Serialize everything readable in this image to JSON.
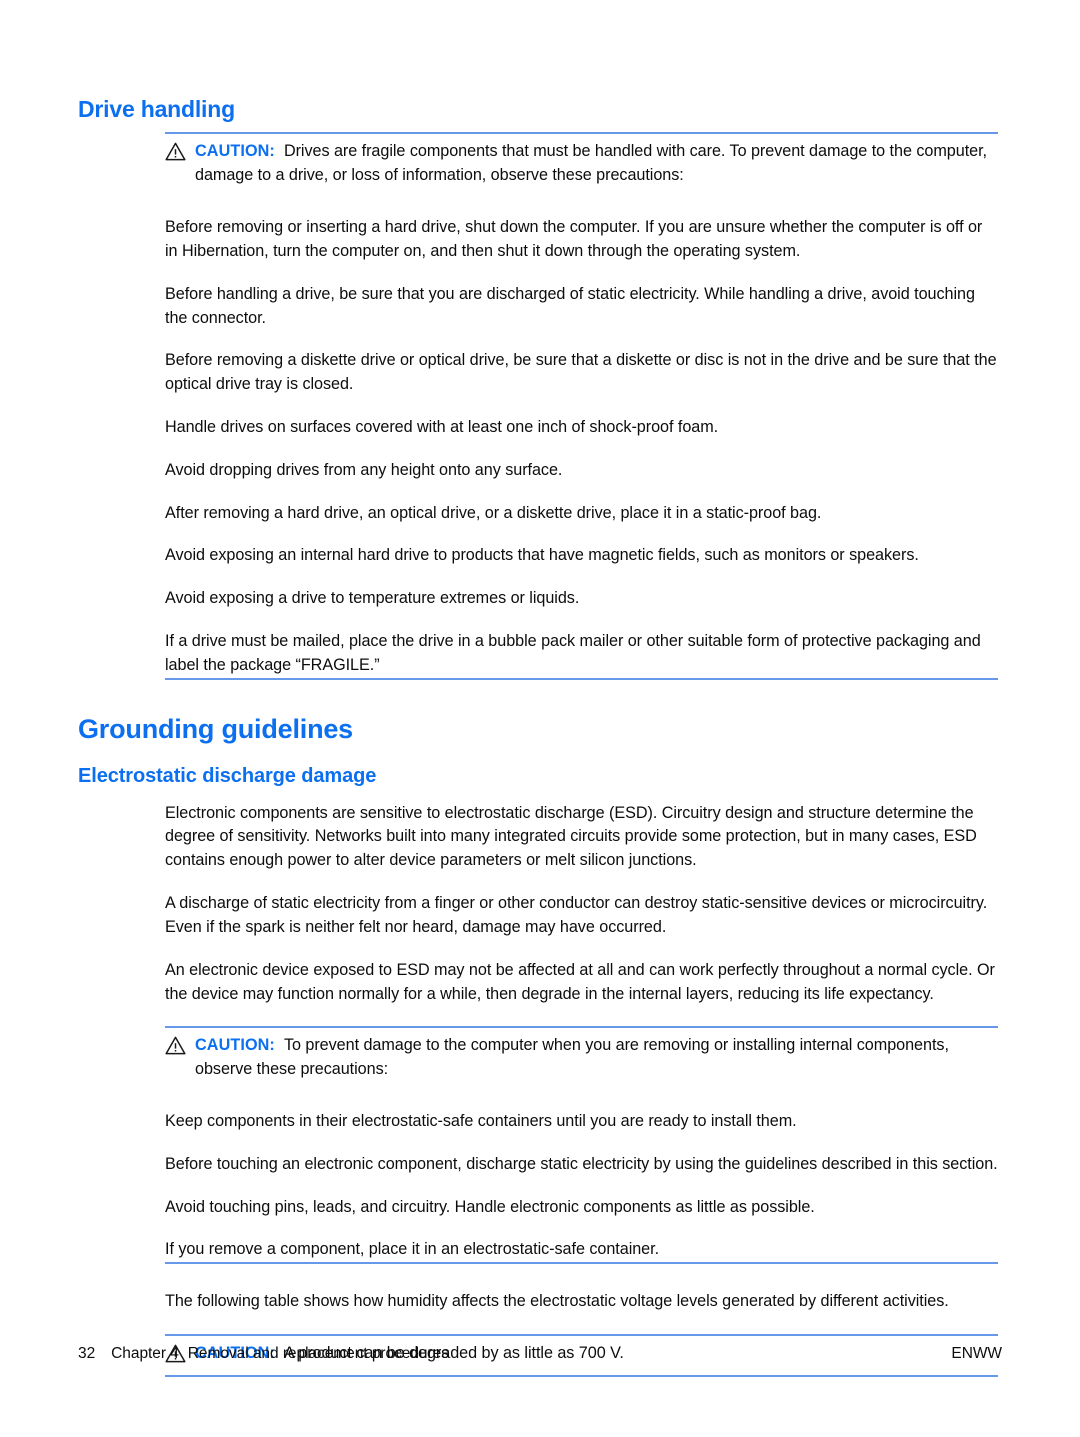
{
  "document": {
    "sections": [
      {
        "heading": "Drive handling",
        "heading_level": "h1",
        "caution_label": "CAUTION:",
        "caution_text": "Drives are fragile components that must be handled with care. To prevent damage to the computer, damage to a drive, or loss of information, observe these precautions:",
        "paragraphs": [
          "Before removing or inserting a hard drive, shut down the computer. If you are unsure whether the computer is off or in Hibernation, turn the computer on, and then shut it down through the operating system.",
          "Before handling a drive, be sure that you are discharged of static electricity. While handling a drive, avoid touching the connector.",
          "Before removing a diskette drive or optical drive, be sure that a diskette or disc is not in the drive and be sure that the optical drive tray is closed.",
          "Handle drives on surfaces covered with at least one inch of shock-proof foam.",
          "Avoid dropping drives from any height onto any surface.",
          "After removing a hard drive, an optical drive, or a diskette drive, place it in a static-proof bag.",
          "Avoid exposing an internal hard drive to products that have magnetic fields, such as monitors or speakers.",
          "Avoid exposing a drive to temperature extremes or liquids.",
          "If a drive must be mailed, place the drive in a bubble pack mailer or other suitable form of protective packaging and label the package “FRAGILE.”"
        ]
      }
    ],
    "grounding_heading": "Grounding guidelines",
    "esd_heading": "Electrostatic discharge damage",
    "esd_paragraphs": [
      "Electronic components are sensitive to electrostatic discharge (ESD). Circuitry design and structure determine the degree of sensitivity. Networks built into many integrated circuits provide some protection, but in many cases, ESD contains enough power to alter device parameters or melt silicon junctions.",
      "A discharge of static electricity from a finger or other conductor can destroy static-sensitive devices or microcircuitry. Even if the spark is neither felt nor heard, damage may have occurred.",
      "An electronic device exposed to ESD may not be affected at all and can work perfectly throughout a normal cycle. Or the device may function normally for a while, then degrade in the internal layers, reducing its life expectancy."
    ],
    "caution2_label": "CAUTION:",
    "caution2_text": "To prevent damage to the computer when you are removing or installing internal components, observe these precautions:",
    "esd_precautions": [
      "Keep components in their electrostatic-safe containers until you are ready to install them.",
      "Before touching an electronic component, discharge static electricity by using the guidelines described in this section.",
      "Avoid touching pins, leads, and circuitry. Handle electronic components as little as possible.",
      "If you remove a component, place it in an electrostatic-safe container."
    ],
    "table_intro": "The following table shows how humidity affects the electrostatic voltage levels generated by different activities.",
    "caution3_label": "CAUTION:",
    "caution3_text": "A product can be degraded by as little as 700 V."
  },
  "footer": {
    "page_number": "32",
    "chapter": "Chapter 4",
    "chapter_title": "Removal and replacement procedures",
    "locale": "ENWW"
  },
  "colors": {
    "heading_blue": "#0b6ff0",
    "rule_blue": "#6699e8",
    "body_black": "#0d0d0d"
  }
}
